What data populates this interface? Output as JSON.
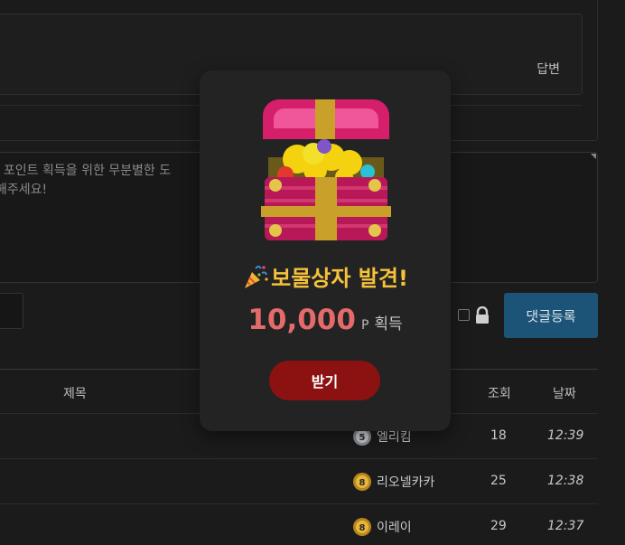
{
  "answer": {
    "label": "답변"
  },
  "comment": {
    "placeholder": ", 포인트 획득을 위한 무분별한 도\n 해주세요!",
    "submit_label": "댓글등록"
  },
  "list": {
    "headers": {
      "title": "제목",
      "views": "조회",
      "date": "날짜"
    },
    "rows": [
      {
        "author": "엘리킴",
        "level": "5",
        "views": "18",
        "date": "12:39"
      },
      {
        "author": "리오넬카카",
        "level": "8",
        "views": "25",
        "date": "12:38"
      },
      {
        "author": "이레이",
        "level": "8",
        "views": "29",
        "date": "12:37"
      }
    ]
  },
  "popup": {
    "title": "보물상자 발견!",
    "amount": "10,000",
    "unit": "P",
    "suffix": "획득",
    "claim_label": "받기"
  },
  "colors": {
    "popup_title": "#f6c13b",
    "amount": "#e56b6b",
    "claim_button": "#8c1212",
    "submit_button": "#1c5477"
  }
}
